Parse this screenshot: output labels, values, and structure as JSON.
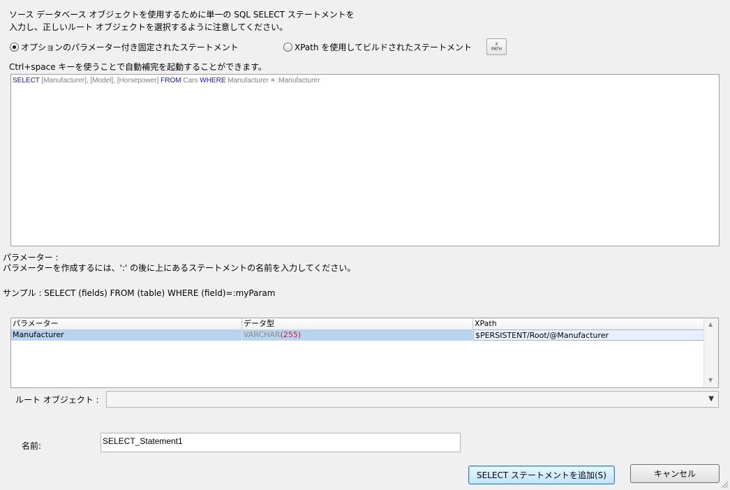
{
  "description": {
    "line1": "ソース データベース オブジェクトを使用するために単一の SQL SELECT ステートメントを",
    "line2": "入力し、正しいルート オブジェクトを選択するように注意してください。"
  },
  "options": {
    "fixed_label": "オプションのパラメーター付き固定されたステートメント",
    "fixed_selected": true,
    "xpath_label": "XPath を使用してビルドされたステートメント",
    "xpath_selected": false,
    "xpath_button": {
      "top": "X",
      "bottom": "PATH"
    }
  },
  "hint": "Ctrl+space キーを使うことで自動補完を起動することができます。",
  "editor": {
    "sql": [
      {
        "t": "SELECT",
        "c": "kw"
      },
      {
        "t": " [Manufacturer], [Model], [Horsepower] ",
        "c": "id"
      },
      {
        "t": "FROM",
        "c": "kw"
      },
      {
        "t": " Cars ",
        "c": "id"
      },
      {
        "t": "WHERE",
        "c": "kw"
      },
      {
        "t": " Manufacturer ",
        "c": "id"
      },
      {
        "t": "=",
        "c": "plain"
      },
      {
        "t": " :Manufacturer",
        "c": "id"
      }
    ]
  },
  "params": {
    "label": "パラメーター :",
    "help": "パラメーターを作成するには、':' の後に上にあるステートメントの名前を入力してください。",
    "sample": "サンプル : SELECT (fields) FROM (table) WHERE (field)=:myParam"
  },
  "grid": {
    "columns": [
      "パラメーター",
      "データ型",
      "XPath"
    ],
    "rows": [
      {
        "name": "Manufacturer",
        "type": "VARCHAR",
        "size": "(255)",
        "xpath": "$PERSISTENT/Root/@Manufacturer"
      }
    ]
  },
  "root_object": {
    "label": "ルート オブジェクト :",
    "value": ""
  },
  "name_field": {
    "label": "名前:",
    "value": "SELECT_Statement1"
  },
  "buttons": {
    "add": "SELECT ステートメントを追加(S)",
    "cancel": "キャンセル"
  }
}
